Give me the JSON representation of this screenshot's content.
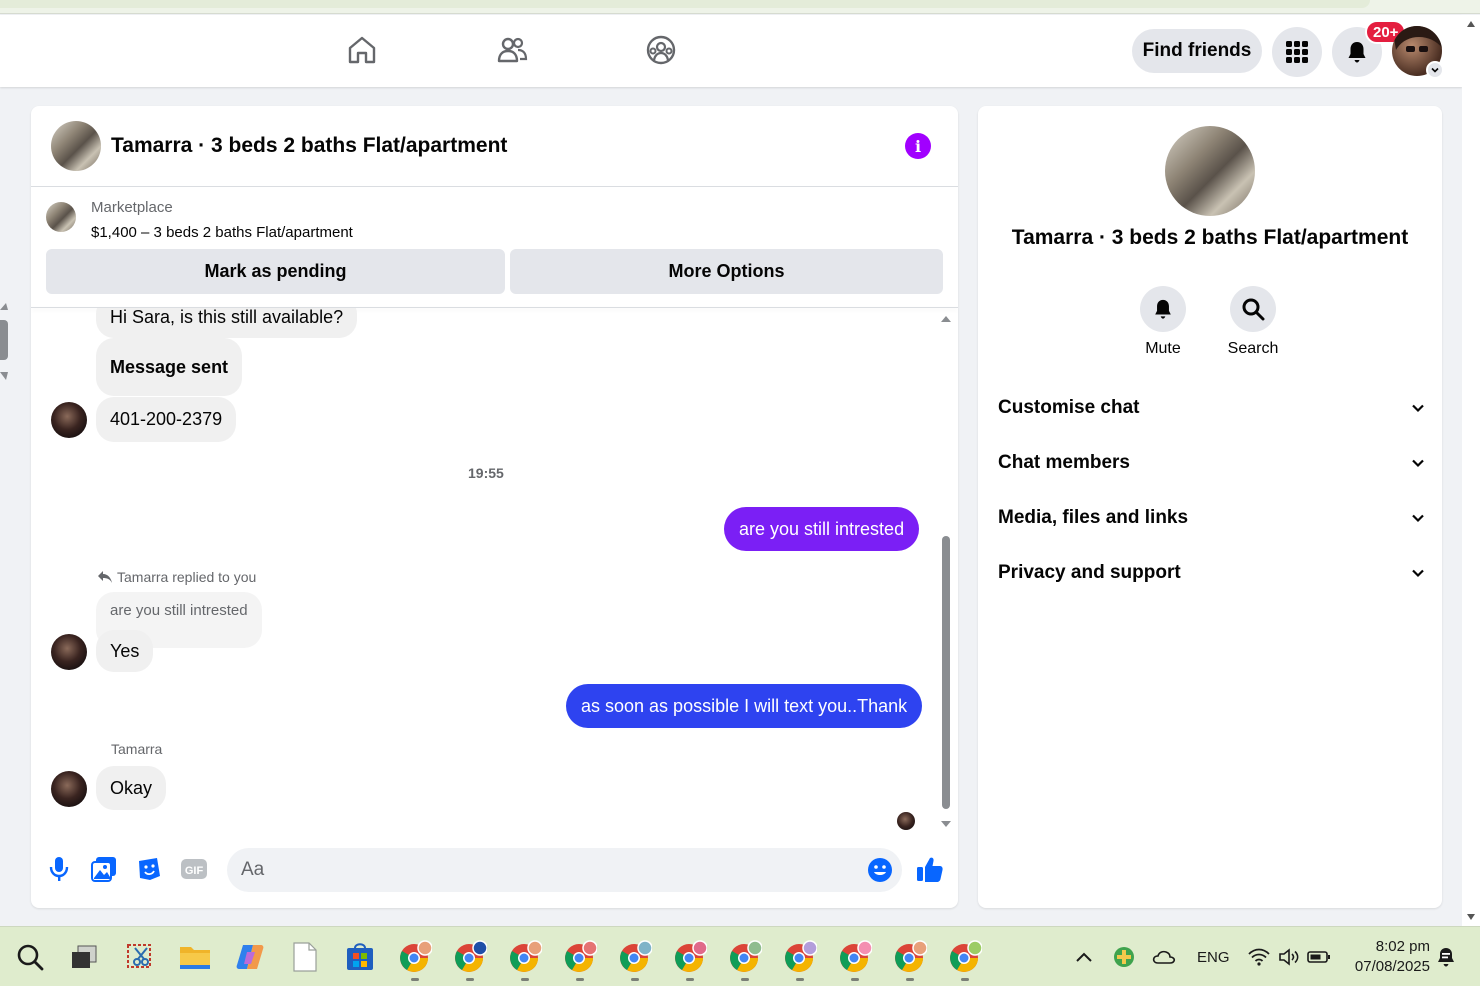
{
  "nav": {
    "find_friends_label": "Find friends",
    "notification_badge": "20+"
  },
  "chat": {
    "title": "Tamarra · 3 beds 2 baths Flat/apartment",
    "marketplace_label": "Marketplace",
    "listing_price_title": "$1,400 – 3 beds 2 baths Flat/apartment",
    "mark_pending_label": "Mark as pending",
    "more_options_label": "More Options",
    "messages": {
      "m1": "Hi Sara, is this still available?",
      "m2": "Message sent",
      "m3": "401-200-2379",
      "timestamp": "19:55",
      "m4": "are you still intrested",
      "reply_label": "Tamarra replied to you",
      "quoted": "are you still intrested",
      "m5": "Yes",
      "m6": "as soon as possible I will text you..Thank",
      "sender_name": "Tamarra",
      "m7": "Okay"
    },
    "composer": {
      "placeholder": "Aa"
    },
    "colors": {
      "outgoing_purple": "#7b1ff5",
      "outgoing_blue": "#2e43f0",
      "info_purple": "#a100ff",
      "accent_blue": "#0866ff"
    }
  },
  "details": {
    "title": "Tamarra · 3 beds 2 baths Flat/apartment",
    "mute_label": "Mute",
    "search_label": "Search",
    "sections": [
      "Customise chat",
      "Chat members",
      "Media, files and links",
      "Privacy and support"
    ]
  },
  "taskbar": {
    "language": "ENG",
    "time": "8:02 pm",
    "date": "07/08/2025"
  }
}
